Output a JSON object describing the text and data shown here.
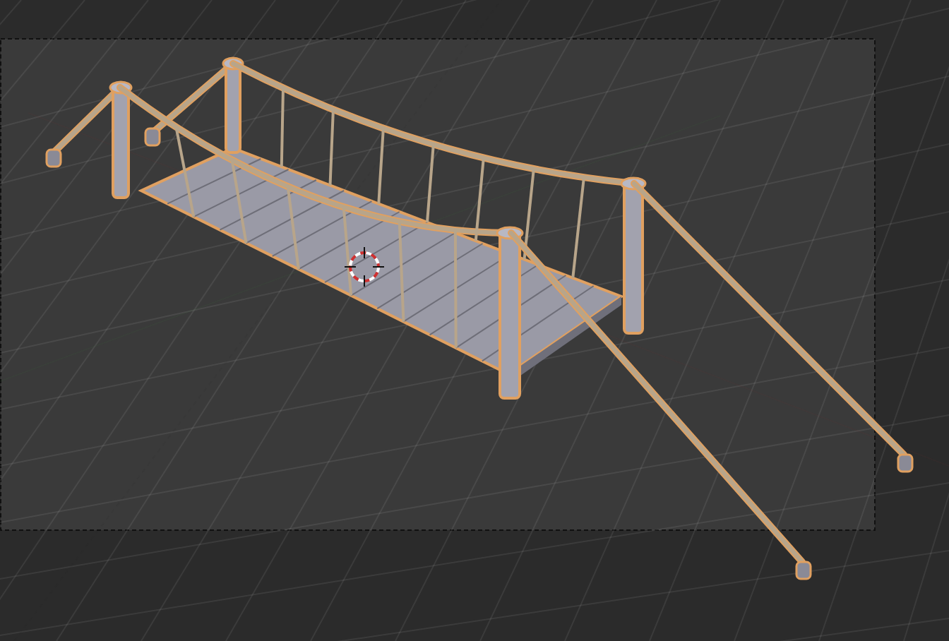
{
  "viewport": {
    "camera_frame": true,
    "objects": [
      {
        "kind": "rope-bridge",
        "selected": true
      }
    ]
  }
}
